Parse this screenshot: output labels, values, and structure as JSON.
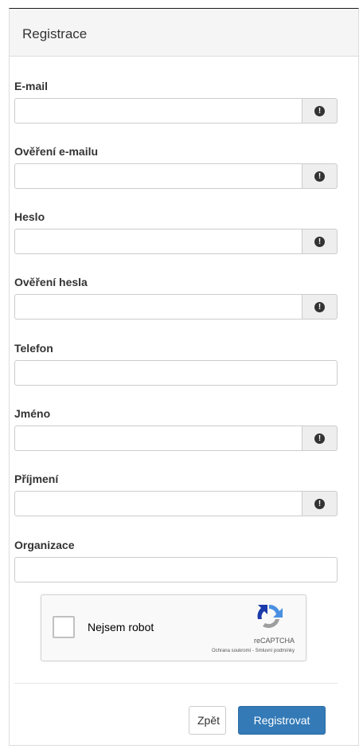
{
  "panel": {
    "title": "Registrace"
  },
  "fields": [
    {
      "label": "E-mail",
      "value": "",
      "has_addon": true,
      "addon_icon": "exclamation-circle-icon"
    },
    {
      "label": "Ověření e-mailu",
      "value": "",
      "has_addon": true,
      "addon_icon": "exclamation-circle-icon"
    },
    {
      "label": "Heslo",
      "value": "",
      "has_addon": true,
      "addon_icon": "exclamation-circle-icon"
    },
    {
      "label": "Ověření hesla",
      "value": "",
      "has_addon": true,
      "addon_icon": "exclamation-circle-icon"
    },
    {
      "label": "Telefon",
      "value": "",
      "has_addon": false
    },
    {
      "label": "Jméno",
      "value": "",
      "has_addon": true,
      "addon_icon": "exclamation-circle-icon"
    },
    {
      "label": "Příjmení",
      "value": "",
      "has_addon": true,
      "addon_icon": "exclamation-circle-icon"
    },
    {
      "label": "Organizace",
      "value": "",
      "has_addon": false
    }
  ],
  "addon_glyph": "!",
  "captcha": {
    "label": "Nejsem robot",
    "brand": "reCAPTCHA",
    "links": "Ochrana soukromí - Smluvní podmínky",
    "checked": false
  },
  "buttons": {
    "back_label": "Zpět",
    "register_label": "Registrovat"
  },
  "colors": {
    "primary": "#337ab7",
    "heading_bg": "#f5f5f5",
    "addon_bg": "#eeeeee"
  }
}
